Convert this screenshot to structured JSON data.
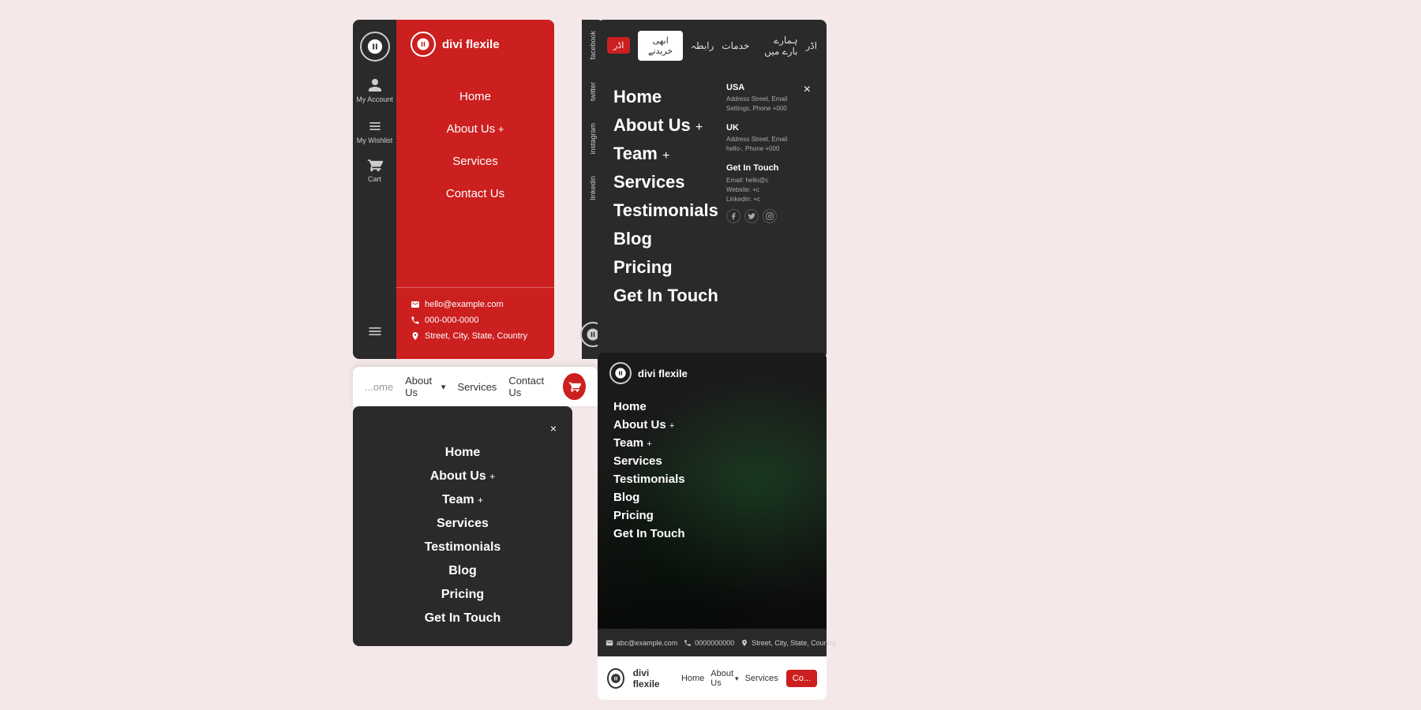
{
  "brand": {
    "name": "divi flexile",
    "logo_alt": "divi flexile logo"
  },
  "panel1": {
    "sidebar": {
      "my_account": "My Account",
      "my_wishlist": "My Wishlist",
      "cart": "Cart"
    },
    "social": [
      "facebook",
      "twitter",
      "instagram",
      "linkedin"
    ],
    "nav": {
      "home": "Home",
      "about_us": "About Us",
      "services": "Services",
      "contact_us": "Contact Us"
    },
    "contact": {
      "email": "hello@example.com",
      "phone": "000-000-0000",
      "address": "Street, City, State, Country"
    }
  },
  "panel2": {
    "close": "×",
    "nav": {
      "home": "Home",
      "about_us": "About Us",
      "team": "Team",
      "services": "Services",
      "testimonials": "Testimonials",
      "blog": "Blog",
      "pricing": "Pricing",
      "get_in_touch": "Get In Touch"
    },
    "contact": {
      "usa_label": "USA",
      "usa_addr": "Address Street, Email Settings, Phone +000",
      "uk_label": "UK",
      "uk_addr": "Address Street, Email hello-, Phone +000",
      "get_in_touch": "Get In Touch",
      "contact_email": "Email: hello@c",
      "website": "Website: +c",
      "linkedin": "Linkedin: +c"
    }
  },
  "panel3": {
    "nav": {
      "home": "اڈر",
      "about": "ہمارے بارے میں",
      "services": "خدمات",
      "contact": "رابطہ"
    },
    "cta": "ابھی خریدنے",
    "flag": "اڈر"
  },
  "panel4": {
    "truncated": "ome",
    "about_us": "About Us",
    "services": "Services",
    "contact_us": "Contact Us"
  },
  "panel5": {
    "close": "×",
    "nav": {
      "home": "Home",
      "about_us": "About Us",
      "team": "Team",
      "services": "Services",
      "testimonials": "Testimonials",
      "blog": "Blog",
      "pricing": "Pricing",
      "get_in_touch": "Get In Touch"
    }
  },
  "panel6": {
    "header": "divi flexile",
    "nav": {
      "home": "Home",
      "about_us": "About Us",
      "team": "Team",
      "services": "Services",
      "testimonials": "Testimonials",
      "blog": "Blog",
      "pricing": "Pricing",
      "get_in_touch": "Get In Touch"
    }
  },
  "panel7": {
    "email": "abc@example.com",
    "phone": "0000000000",
    "address": "Street, City, State, Country"
  },
  "panel8": {
    "brand": "divi flexile",
    "nav": {
      "home": "Home",
      "about_us": "About Us",
      "services": "Services"
    },
    "cta": "Co..."
  }
}
